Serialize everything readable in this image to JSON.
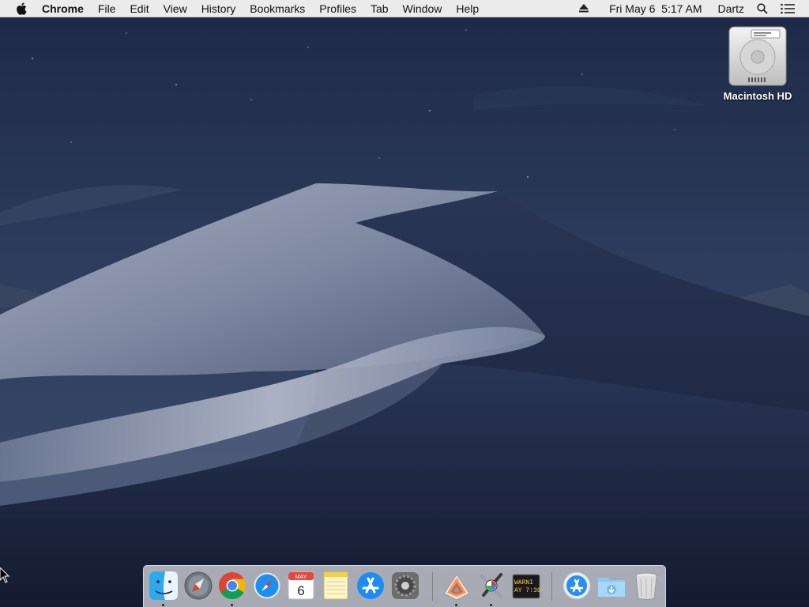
{
  "menubar": {
    "apple_icon": "apple-icon",
    "app_name": "Chrome",
    "menus": [
      "File",
      "Edit",
      "View",
      "History",
      "Bookmarks",
      "Profiles",
      "Tab",
      "Window",
      "Help"
    ],
    "status": {
      "eject_icon": "eject-icon",
      "datetime": "Fri May 6  5:17 AM",
      "user": "Dartz",
      "search_icon": "spotlight-search-icon",
      "notification_icon": "notification-center-icon"
    }
  },
  "desktop": {
    "icons": [
      {
        "label": "Macintosh HD",
        "icon": "hard-drive-icon"
      }
    ]
  },
  "dock": {
    "apps": [
      {
        "name": "Finder",
        "icon": "finder-icon",
        "running": true
      },
      {
        "name": "Launchpad",
        "icon": "launchpad-icon",
        "running": false
      },
      {
        "name": "Google Chrome",
        "icon": "chrome-icon",
        "running": true
      },
      {
        "name": "Safari",
        "icon": "safari-icon",
        "running": false
      },
      {
        "name": "Calendar",
        "icon": "calendar-icon",
        "running": false,
        "badge_month": "MAY",
        "badge_day": "6"
      },
      {
        "name": "Notes",
        "icon": "notes-icon",
        "running": false
      },
      {
        "name": "App Store",
        "icon": "app-store-icon",
        "running": false
      },
      {
        "name": "System Preferences",
        "icon": "system-preferences-icon",
        "running": false
      },
      {
        "name": "Grapher",
        "icon": "grapher-icon",
        "running": true
      },
      {
        "name": "Utilities",
        "icon": "utilities-icon",
        "running": true
      },
      {
        "name": "Console",
        "icon": "console-icon",
        "running": false,
        "line1": "WARNI",
        "line2": "AY 7:36"
      },
      {
        "name": "Applications",
        "icon": "applications-folder-icon",
        "running": false
      },
      {
        "name": "Downloads",
        "icon": "downloads-folder-icon",
        "running": false
      },
      {
        "name": "Trash",
        "icon": "trash-icon",
        "running": false
      }
    ]
  },
  "colors": {
    "menubar_bg": "#ecebeb",
    "sky_top": "#1f2c4a",
    "sky_bottom": "#3b4b6b",
    "dune_light": "#8d97ad",
    "dune_dark": "#1c2540"
  }
}
